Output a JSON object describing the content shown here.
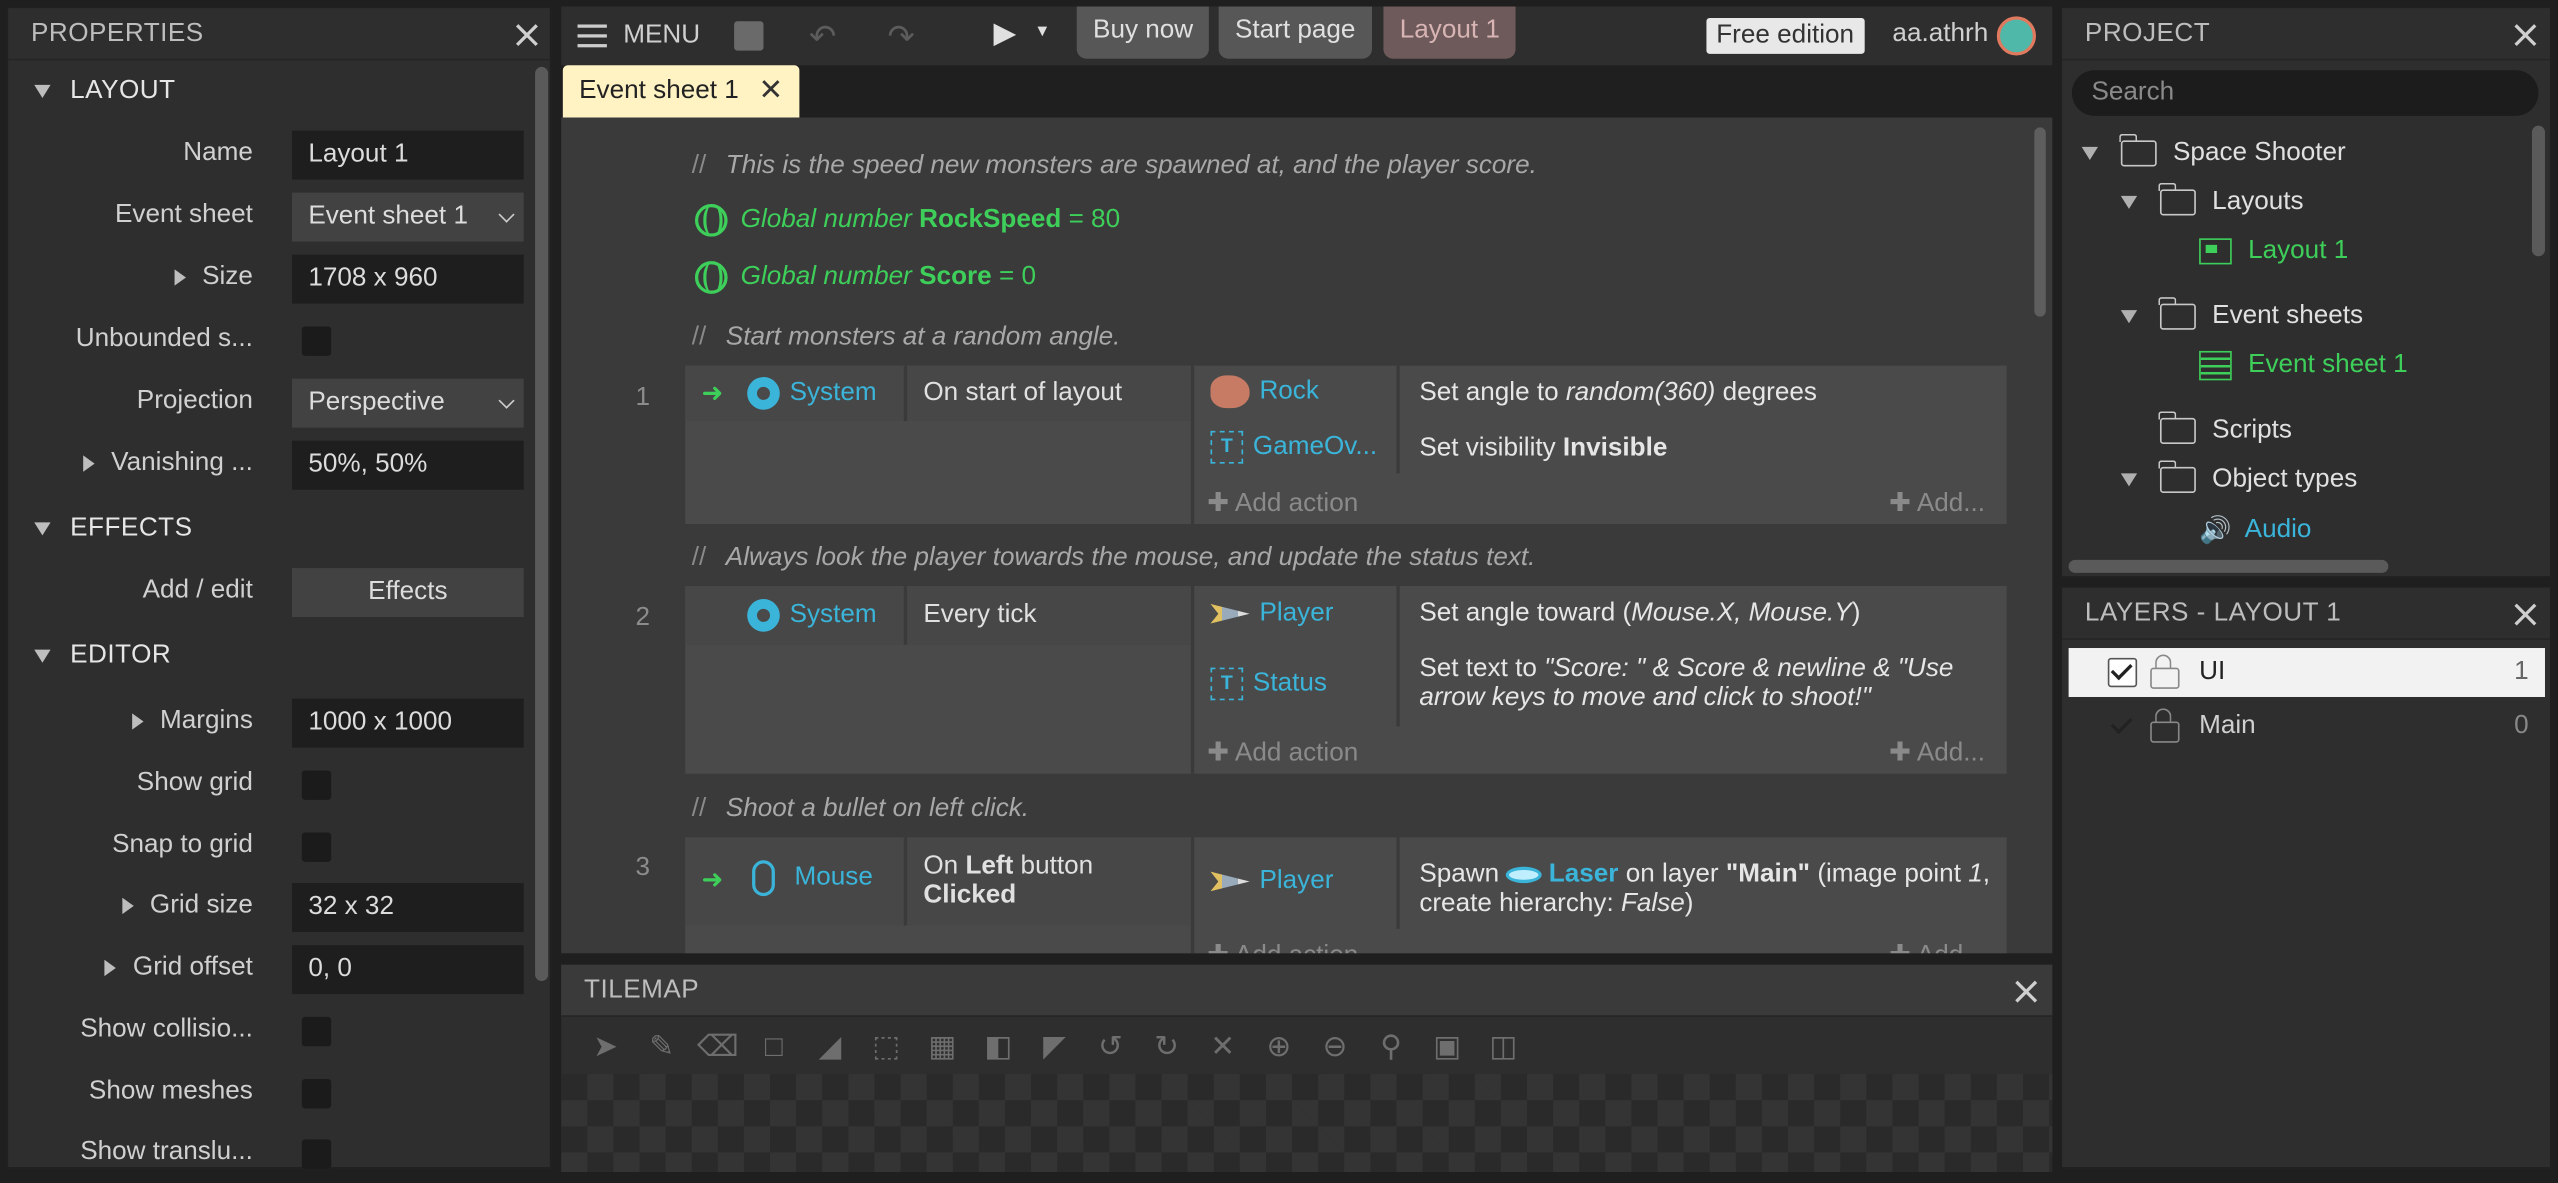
{
  "properties": {
    "title": "PROPERTIES",
    "layout_section": "LAYOUT",
    "name_label": "Name",
    "name_value": "Layout 1",
    "eventsheet_label": "Event sheet",
    "eventsheet_value": "Event sheet 1",
    "size_label": "Size",
    "size_value": "1708 x 960",
    "unbounded_label": "Unbounded s...",
    "projection_label": "Projection",
    "projection_value": "Perspective",
    "vanishing_label": "Vanishing ...",
    "vanishing_value": "50%, 50%",
    "effects_section": "EFFECTS",
    "addedit_label": "Add / edit",
    "effects_button": "Effects",
    "editor_section": "EDITOR",
    "margins_label": "Margins",
    "margins_value": "1000 x 1000",
    "showgrid_label": "Show grid",
    "snap_label": "Snap to grid",
    "gridsize_label": "Grid size",
    "gridsize_value": "32 x 32",
    "gridoffset_label": "Grid offset",
    "gridoffset_value": "0, 0",
    "showcollision_label": "Show collisio...",
    "showmeshes_label": "Show meshes",
    "showtransl_label": "Show translu..."
  },
  "toolbar": {
    "menu": "MENU",
    "buy": "Buy now",
    "start": "Start page",
    "layout": "Layout 1",
    "edition": "Free edition",
    "user": "aa.athrh"
  },
  "tab": {
    "label": "Event sheet 1"
  },
  "events": {
    "c1": "This is the speed new monsters are spawned at, and the player score.",
    "g1_pre": "Global number",
    "g1_name": "RockSpeed",
    "g1_val": "= 80",
    "g2_pre": "Global number",
    "g2_name": "Score",
    "g2_val": "= 0",
    "c2": "Start monsters at a random angle.",
    "e1_num": "1",
    "e1_obj": "System",
    "e1_cond": "On start of layout",
    "e1_a1_obj": "Rock",
    "e1_a1_pre": "Set angle to ",
    "e1_a1_it": "random(360)",
    "e1_a1_post": " degrees",
    "e1_a2_obj": "GameOv...",
    "e1_a2_pre": "Set visibility ",
    "e1_a2_b": "Invisible",
    "add_action": "Add action",
    "add_short": "Add...",
    "c3": "Always look the player towards the mouse, and update the status text.",
    "e2_num": "2",
    "e2_obj": "System",
    "e2_cond": "Every tick",
    "e2_a1_obj": "Player",
    "e2_a1_pre": "Set angle toward (",
    "e2_a1_it": "Mouse.X, Mouse.Y",
    "e2_a1_post": ")",
    "e2_a2_obj": "Status",
    "e2_a2_pre": "Set text to ",
    "e2_a2_it": "\"Score: \" & Score & newline & \"Use arrow keys to move and click to shoot!\"",
    "c4": "Shoot a bullet on left click.",
    "e3_num": "3",
    "e3_obj": "Mouse",
    "e3_cond_pre": "On ",
    "e3_cond_b1": "Left",
    "e3_cond_mid": " button",
    "e3_cond_b2": "Clicked",
    "e3_a1_obj": "Player",
    "e3_a1_pre": "Spawn ",
    "e3_a1_b": "Laser",
    "e3_a1_mid": " on layer ",
    "e3_a1_b2": "\"Main\"",
    "e3_a1_post": " (image point ",
    "e3_a1_it1": "1",
    "e3_a1_post2": ", create hierarchy: ",
    "e3_a1_it2": "False",
    "e3_a1_end": ")"
  },
  "tilemap": {
    "title": "TILEMAP"
  },
  "project": {
    "title": "PROJECT",
    "search_placeholder": "Search",
    "root": "Space Shooter",
    "layouts": "Layouts",
    "layout1": "Layout 1",
    "eventsheets": "Event sheets",
    "eventsheet1": "Event sheet 1",
    "scripts": "Scripts",
    "objecttypes": "Object types",
    "audio": "Audio"
  },
  "layers": {
    "title": "LAYERS - LAYOUT 1",
    "items": [
      {
        "name": "UI",
        "index": "1"
      },
      {
        "name": "Main",
        "index": "0"
      }
    ]
  },
  "colors": {
    "accent_green": "#3ecf5a",
    "accent_blue": "#3bb4d9",
    "tab_bg": "#fff3c4"
  }
}
